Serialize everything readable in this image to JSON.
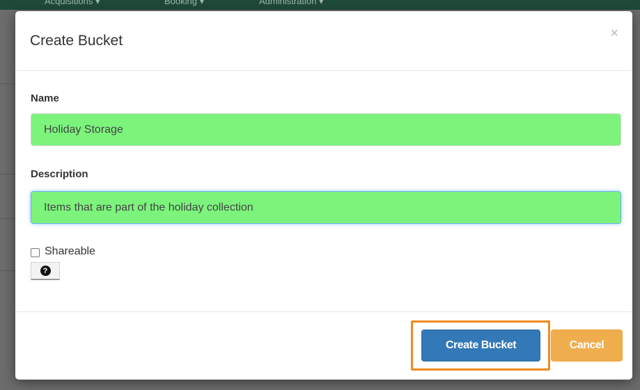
{
  "background_nav": {
    "items": [
      "Acquisitions ▾",
      "Booking ▾",
      "Administration ▾"
    ]
  },
  "modal": {
    "title": "Create Bucket",
    "close_label": "×",
    "name": {
      "label": "Name",
      "value": "Holiday Storage"
    },
    "description": {
      "label": "Description",
      "value": "Items that are part of the holiday collection"
    },
    "shareable": {
      "label": "Shareable",
      "checked": false
    },
    "help_label": "?",
    "footer": {
      "create_label": "Create Bucket",
      "cancel_label": "Cancel"
    }
  },
  "colors": {
    "field_highlight": "#7cf47c",
    "primary": "#3378b7",
    "warning": "#f0ad4e",
    "callout": "#f08a1c",
    "nav": "#1f4a3a"
  }
}
